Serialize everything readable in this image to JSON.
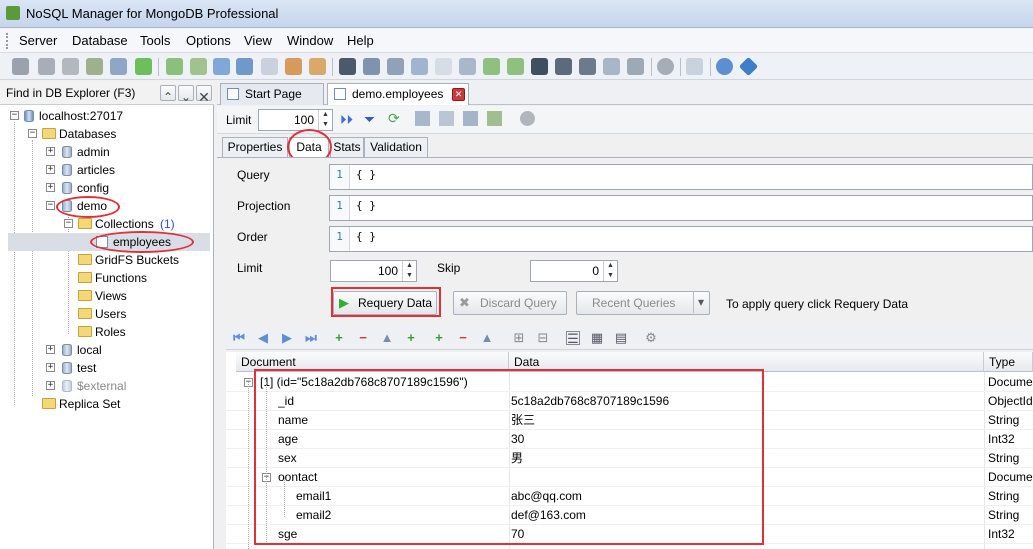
{
  "window": {
    "title": "NoSQL Manager for MongoDB Professional"
  },
  "menu": [
    "Server",
    "Database",
    "Tools",
    "Options",
    "View",
    "Window",
    "Help"
  ],
  "explorer": {
    "find_label": "Find in DB Explorer (F3)",
    "tree": {
      "server": "localhost:27017",
      "databases": "Databases",
      "admin": "admin",
      "articles": "articles",
      "config": "config",
      "demo": "demo",
      "collections": "Collections",
      "collections_count": "(1)",
      "employees": "employees",
      "gridfs": "GridFS Buckets",
      "functions": "Functions",
      "views": "Views",
      "users": "Users",
      "roles": "Roles",
      "local": "local",
      "test": "test",
      "external": "$external",
      "replica": "Replica Set"
    }
  },
  "tabs": {
    "start": "Start Page",
    "active": "demo.employees"
  },
  "subtoolbar": {
    "limit_label": "Limit",
    "limit_value": "100"
  },
  "subtabs": [
    "Properties",
    "Data",
    "Stats",
    "Validation"
  ],
  "query": {
    "query_label": "Query",
    "projection_label": "Projection",
    "order_label": "Order",
    "line_no": "1",
    "query_value": "{ }",
    "projection_value": "{ }",
    "order_value": "{ }",
    "limit_label": "Limit",
    "limit_value": "100",
    "skip_label": "Skip",
    "skip_value": "0",
    "requery_button": "Requery Data",
    "discard_button": "Discard Query",
    "recent_button": "Recent Queries",
    "hint": "To apply query click Requery Data"
  },
  "grid": {
    "headers": {
      "document": "Document",
      "data": "Data",
      "type": "Type"
    },
    "rows": [
      {
        "doc": "[1] (id=\"5c18a2db768c8707189c1596\")",
        "data": "",
        "type": "Document"
      },
      {
        "doc": "_id",
        "data": "5c18a2db768c8707189c1596",
        "type": "ObjectId"
      },
      {
        "doc": "name",
        "data": "张三",
        "type": "String"
      },
      {
        "doc": "age",
        "data": "30",
        "type": "Int32"
      },
      {
        "doc": "sex",
        "data": "男",
        "type": "String"
      },
      {
        "doc": "oontact",
        "data": "",
        "type": "Document"
      },
      {
        "doc": "email1",
        "data": "abc@qq.com",
        "type": "String"
      },
      {
        "doc": "email2",
        "data": "def@163.com",
        "type": "String"
      },
      {
        "doc": "sge",
        "data": "70",
        "type": "Int32"
      }
    ]
  },
  "colors": {
    "accent_red": "#e0303a",
    "play_green": "#2fb12f"
  }
}
